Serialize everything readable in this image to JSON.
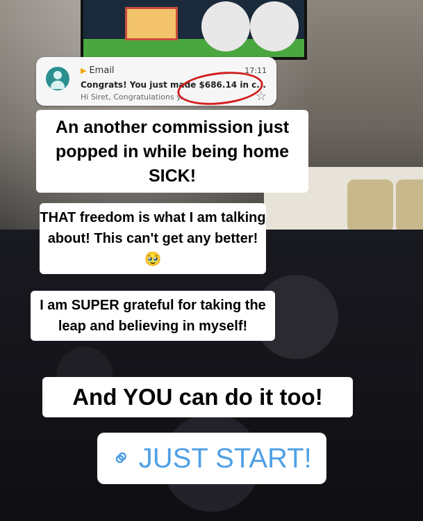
{
  "notification": {
    "app_name": "Email",
    "time": "17:11",
    "subject": "Congrats! You just made $686.14 in c...",
    "preview": "Hi Siret, Congratulations y...",
    "star_icon": "star-icon"
  },
  "captions": {
    "line1": "An another commission just popped in while being home",
    "line1_end": "SICK!",
    "line2": "THAT freedom is what I am talking about! This can't get any better! 🥹",
    "line3": "I am SUPER grateful for taking the leap and believing in myself!",
    "line4": "And YOU can do it too!"
  },
  "link_sticker": {
    "icon": "link-icon",
    "label": "JUST START!",
    "color": "#4fa0e6"
  }
}
